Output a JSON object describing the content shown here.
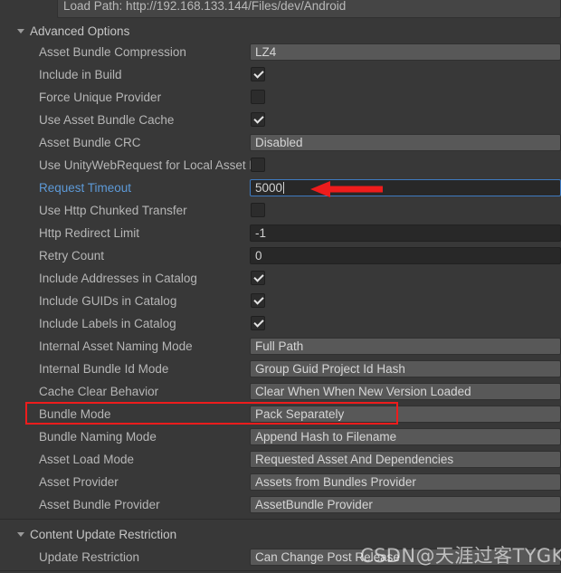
{
  "window": {
    "background_color": "#383838",
    "accent_blue": "#5d9ad8",
    "annotation_red": "#ee1c1c"
  },
  "load_path": {
    "value": "Load Path: http://192.168.133.144/Files/dev/Android"
  },
  "sections": [
    {
      "id": "advanced-options",
      "label": "Advanced Options",
      "expanded": true
    },
    {
      "id": "content-update-restriction",
      "label": "Content Update Restriction",
      "expanded": true
    }
  ],
  "advanced_options": {
    "fields": [
      {
        "label": "Asset Bundle Compression",
        "type": "popup",
        "value": "LZ4"
      },
      {
        "label": "Include in Build",
        "type": "checkbox",
        "value": true
      },
      {
        "label": "Force Unique Provider",
        "type": "checkbox",
        "value": false
      },
      {
        "label": "Use Asset Bundle Cache",
        "type": "checkbox",
        "value": true
      },
      {
        "label": "Asset Bundle CRC",
        "type": "popup",
        "value": "Disabled"
      },
      {
        "label": "Use UnityWebRequest for Local Asset Bundles",
        "type": "checkbox",
        "value": false
      },
      {
        "label": "Request Timeout",
        "type": "number",
        "value": "5000",
        "focused": true,
        "label_highlighted": true
      },
      {
        "label": "Use Http Chunked Transfer",
        "type": "checkbox",
        "value": false
      },
      {
        "label": "Http Redirect Limit",
        "type": "number",
        "value": "-1"
      },
      {
        "label": "Retry Count",
        "type": "number",
        "value": "0"
      },
      {
        "label": "Include Addresses in Catalog",
        "type": "checkbox",
        "value": true
      },
      {
        "label": "Include GUIDs in Catalog",
        "type": "checkbox",
        "value": true
      },
      {
        "label": "Include Labels in Catalog",
        "type": "checkbox",
        "value": true
      },
      {
        "label": "Internal Asset Naming Mode",
        "type": "popup",
        "value": "Full Path"
      },
      {
        "label": "Internal Bundle Id Mode",
        "type": "popup",
        "value": "Group Guid Project Id Hash"
      },
      {
        "label": "Cache Clear Behavior",
        "type": "popup",
        "value": "Clear When When New Version Loaded"
      },
      {
        "label": "Bundle Mode",
        "type": "popup",
        "value": "Pack Separately",
        "highlighted": true
      },
      {
        "label": "Bundle Naming Mode",
        "type": "popup",
        "value": "Append Hash to Filename"
      },
      {
        "label": "Asset Load Mode",
        "type": "popup",
        "value": "Requested Asset And Dependencies"
      },
      {
        "label": "Asset Provider",
        "type": "popup",
        "value": "Assets from Bundles Provider"
      },
      {
        "label": "Asset Bundle Provider",
        "type": "popup",
        "value": "AssetBundle Provider"
      }
    ]
  },
  "content_update_restriction": {
    "fields": [
      {
        "label": "Update Restriction",
        "type": "popup",
        "value": "Can Change Post Release"
      }
    ]
  },
  "annotations": {
    "arrow": {
      "name": "red-left-arrow",
      "points_to": "Request Timeout"
    },
    "box": {
      "name": "red-rectangle",
      "encloses": "Bundle Mode"
    }
  },
  "watermark": {
    "text": "CSDN@天涯过客TYGK"
  }
}
